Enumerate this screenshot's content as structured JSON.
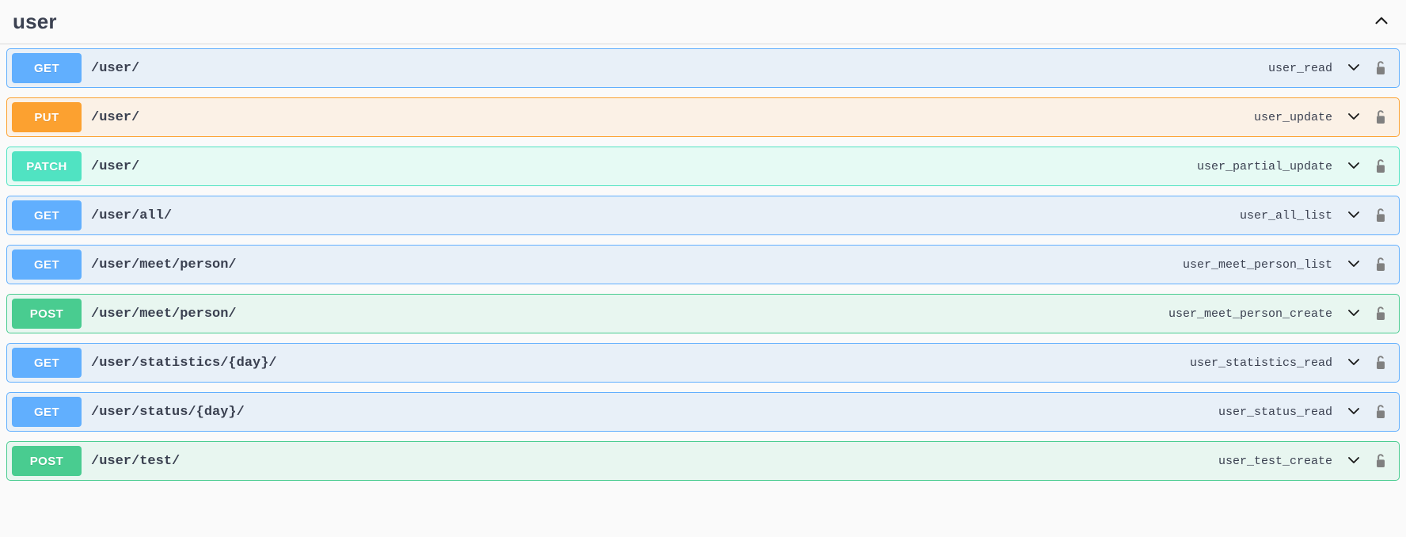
{
  "tag": {
    "name": "user",
    "toggle_icon": "chevron-up-icon",
    "expanded": true
  },
  "colors": {
    "get": "#61affe",
    "put": "#fca130",
    "post": "#49cc90",
    "patch": "#50e3c2",
    "get_bg": "#e8f0f8",
    "put_bg": "#fbf1e6",
    "post_bg": "#e8f6f0",
    "patch_bg": "#e6faf4",
    "text": "#3b4151",
    "page_bg": "#fafafa",
    "lock": "#808080"
  },
  "operations": [
    {
      "method": "GET",
      "method_key": "get",
      "path": "/user/",
      "operation_id": "user_read",
      "expand_icon": "chevron-down-icon",
      "auth_icon": "unlocked-padlock-icon"
    },
    {
      "method": "PUT",
      "method_key": "put",
      "path": "/user/",
      "operation_id": "user_update",
      "expand_icon": "chevron-down-icon",
      "auth_icon": "unlocked-padlock-icon"
    },
    {
      "method": "PATCH",
      "method_key": "patch",
      "path": "/user/",
      "operation_id": "user_partial_update",
      "expand_icon": "chevron-down-icon",
      "auth_icon": "unlocked-padlock-icon"
    },
    {
      "method": "GET",
      "method_key": "get",
      "path": "/user/all/",
      "operation_id": "user_all_list",
      "expand_icon": "chevron-down-icon",
      "auth_icon": "unlocked-padlock-icon"
    },
    {
      "method": "GET",
      "method_key": "get",
      "path": "/user/meet/person/",
      "operation_id": "user_meet_person_list",
      "expand_icon": "chevron-down-icon",
      "auth_icon": "unlocked-padlock-icon"
    },
    {
      "method": "POST",
      "method_key": "post",
      "path": "/user/meet/person/",
      "operation_id": "user_meet_person_create",
      "expand_icon": "chevron-down-icon",
      "auth_icon": "unlocked-padlock-icon"
    },
    {
      "method": "GET",
      "method_key": "get",
      "path": "/user/statistics/{day}/",
      "operation_id": "user_statistics_read",
      "expand_icon": "chevron-down-icon",
      "auth_icon": "unlocked-padlock-icon"
    },
    {
      "method": "GET",
      "method_key": "get",
      "path": "/user/status/{day}/",
      "operation_id": "user_status_read",
      "expand_icon": "chevron-down-icon",
      "auth_icon": "unlocked-padlock-icon"
    },
    {
      "method": "POST",
      "method_key": "post",
      "path": "/user/test/",
      "operation_id": "user_test_create",
      "expand_icon": "chevron-down-icon",
      "auth_icon": "unlocked-padlock-icon"
    }
  ]
}
